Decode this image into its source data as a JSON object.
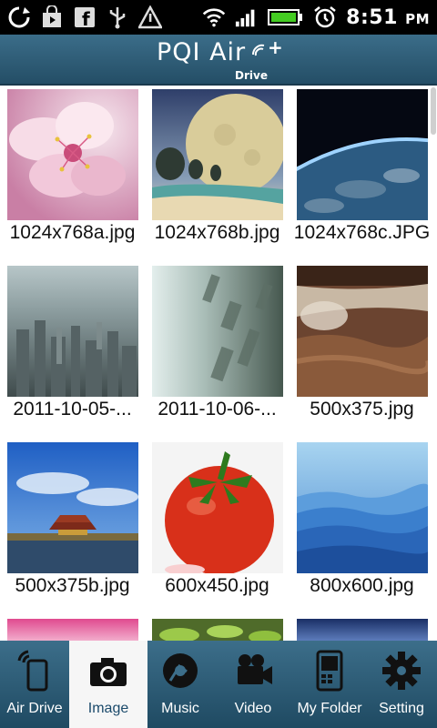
{
  "status_bar": {
    "time": "8:51",
    "ampm": "PM",
    "left_icons": [
      "sync-icon",
      "shopping-bag-icon",
      "facebook-icon",
      "usb-icon",
      "warning-icon"
    ],
    "right_icons": [
      "wifi-icon",
      "signal-icon",
      "battery-icon",
      "alarm-icon"
    ]
  },
  "header": {
    "brand": "PQI Air",
    "sub": "Drive",
    "plus": "+"
  },
  "images": [
    {
      "name": "1024x768a.jpg",
      "icon": "cherry-blossom-thumbnail"
    },
    {
      "name": "1024x768b.jpg",
      "icon": "moon-beach-thumbnail"
    },
    {
      "name": "1024x768c.JPG",
      "icon": "earth-horizon-thumbnail"
    },
    {
      "name": "2011-10-05-...",
      "icon": "city-aerial-thumbnail"
    },
    {
      "name": "2011-10-06-...",
      "icon": "city-tilted-thumbnail"
    },
    {
      "name": "500x375.jpg",
      "icon": "waterfall-thumbnail"
    },
    {
      "name": "500x375b.jpg",
      "icon": "palace-thumbnail"
    },
    {
      "name": "600x450.jpg",
      "icon": "tomato-thumbnail"
    },
    {
      "name": "800x600.jpg",
      "icon": "blue-mountains-thumbnail"
    }
  ],
  "nav": {
    "tabs": [
      {
        "label": "Air Drive",
        "icon": "phone-wireless-icon"
      },
      {
        "label": "Image",
        "icon": "camera-icon"
      },
      {
        "label": "Music",
        "icon": "music-disc-icon"
      },
      {
        "label": "Video",
        "icon": "video-camera-icon"
      },
      {
        "label": "My Folder",
        "icon": "device-folder-icon"
      },
      {
        "label": "Setting",
        "icon": "gear-icon"
      }
    ],
    "active": "Image"
  }
}
